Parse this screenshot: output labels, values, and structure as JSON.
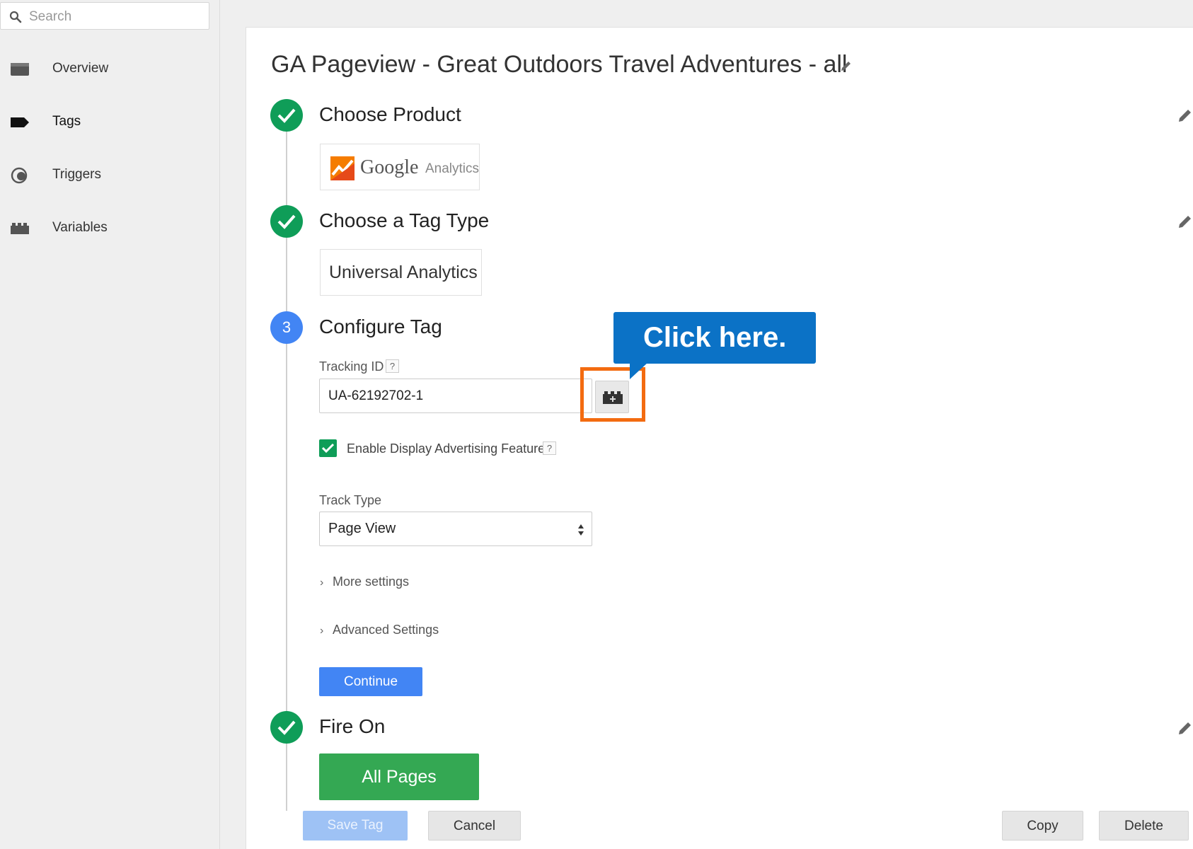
{
  "sidebar": {
    "search_placeholder": "Search",
    "items": [
      {
        "label": "Overview",
        "icon": "folder-icon"
      },
      {
        "label": "Tags",
        "icon": "tag-icon"
      },
      {
        "label": "Triggers",
        "icon": "trigger-icon"
      },
      {
        "label": "Variables",
        "icon": "variables-icon"
      }
    ],
    "active_item": "Tags"
  },
  "main": {
    "title": "GA Pageview - Great Outdoors Travel Adventures - all",
    "steps": {
      "choose_product": {
        "title": "Choose Product",
        "product_google": "Google",
        "product_analytics": "Analytics"
      },
      "choose_tag_type": {
        "title": "Choose a Tag Type",
        "value": "Universal Analytics"
      },
      "configure_tag": {
        "number": "3",
        "title": "Configure Tag",
        "tracking_label": "Tracking ID",
        "help": "?",
        "tracking_value": "UA-62192702-1",
        "enable_display_label": "Enable Display Advertising Features",
        "enable_display_checked": true,
        "track_type_label": "Track Type",
        "track_type_value": "Page View",
        "more_settings": "More settings",
        "advanced_settings": "Advanced Settings",
        "continue_label": "Continue"
      },
      "fire_on": {
        "title": "Fire On",
        "trigger": "All Pages"
      }
    },
    "callout": "Click here.",
    "footer": {
      "save": "Save Tag",
      "cancel": "Cancel",
      "copy": "Copy",
      "delete": "Delete"
    }
  },
  "colors": {
    "accent_blue": "#4285f4",
    "success_green": "#0f9d58",
    "trigger_green": "#34a853",
    "callout_blue": "#0b72c6",
    "highlight_orange": "#f36b10"
  }
}
